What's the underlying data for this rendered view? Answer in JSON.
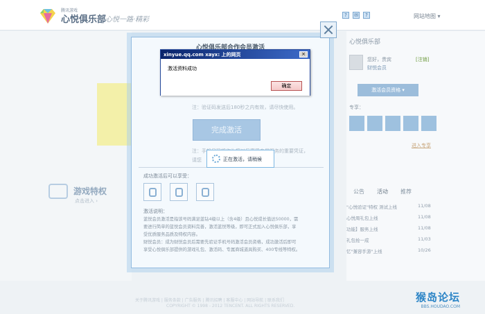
{
  "header": {
    "logo_small": "腾讯游戏",
    "logo_title": "心悦俱乐部",
    "slogan": "心悦一路·精彩",
    "top_icons": [
      "?",
      "✉",
      "?"
    ],
    "sitemap": "网站地图 ▾"
  },
  "background": {
    "game_title": "游戏特权",
    "game_link": "点击进入 ›",
    "right": {
      "title": "心悦俱乐部",
      "user_greeting": "您好，贵宾",
      "user_level": "财悦会员",
      "switch_label": "[注销]",
      "activate_button": "激活会员资格 ▾",
      "privilege_label": "专享：",
      "more_link": "进入专享",
      "tabs": [
        "公告",
        "活动",
        "推荐"
      ],
      "news": [
        {
          "title": "\"心悦验证\"特权 测试上线",
          "date": "11/08"
        },
        {
          "title": "心悦周礼包上线",
          "date": "11/08"
        },
        {
          "title": "功能】服务上线",
          "date": "11/08"
        },
        {
          "title": "礼包抢一成",
          "date": "11/03"
        },
        {
          "title": "忆\"兼容手游\"上线",
          "date": "10/26"
        }
      ]
    },
    "footer_links": "关于腾讯游戏 | 服务条款 | 广告服务 | 腾讯招聘 | 客服中心 | 网站导航 | 联系我们",
    "footer_copy": "COPYRIGHT © 1998 - 2012 TENCENT. ALL RIGHTS RESERVED."
  },
  "modal": {
    "title": "心悦俱乐部合作会员激活",
    "note1": "注：验证码发送后180秒之内有效，请尽快使用。",
    "finish_button": "完成激活",
    "note2": "注：手机号码将作为您以后享受专属服务的重要凭证，",
    "note3": "请您",
    "processing": "正在激活，请稍候",
    "benefits_label": "成功激活后可以享受：",
    "desc_title": "激活说明：",
    "desc_lines": [
      "蓝悦会员激活是指该号码满足蓝钻4级以上（含4级）且心悦成长值达50000，需",
      "要进行简单的蓝悦会员资料完善，激活蓝悦等级，即可正式加入心悦俱乐部，享",
      "受优质服务品质及特权内容。",
      "财悦会员：成为财悦会员后需要先验证手机号码激活会员资格，成功激活后即可",
      "享受心悦俱乐部提供的游戏礼包、激活码、专属商城道具购买、400专线等特权。"
    ]
  },
  "alert": {
    "title": "xinyue.qq.com xayx: 上的网页",
    "close": "×",
    "message": "激活资料成功",
    "ok": "确定"
  },
  "watermark": {
    "main": "猴岛论坛",
    "sub": "BBS.HOUDAO.COM"
  },
  "colors": {
    "accent": "#2b84c6",
    "modal_border": "#93bbe0",
    "alert_titlebar": "#0a246a"
  }
}
